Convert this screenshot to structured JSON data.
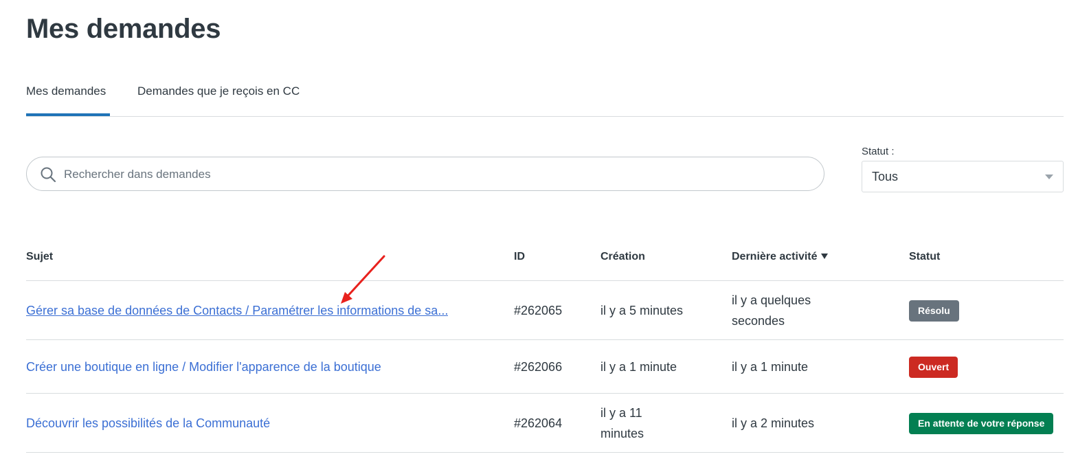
{
  "page": {
    "title": "Mes demandes"
  },
  "tabs": [
    {
      "label": "Mes demandes",
      "active": true
    },
    {
      "label": "Demandes que je reçois en CC",
      "active": false
    }
  ],
  "search": {
    "placeholder": "Rechercher dans demandes",
    "icon": "search-icon"
  },
  "status_filter": {
    "label": "Statut :",
    "selected": "Tous"
  },
  "table": {
    "headers": {
      "subject": "Sujet",
      "id": "ID",
      "created": "Création",
      "last_activity": "Dernière activité",
      "status": "Statut"
    },
    "rows": [
      {
        "subject": "Gérer sa base de données de Contacts / Paramétrer les informations de sa...",
        "id": "#262065",
        "created": "il y a 5 minutes",
        "last_activity": "il y a quelques secondes",
        "status": "Résolu",
        "status_color": "#68737d"
      },
      {
        "subject": "Créer une boutique en ligne / Modifier l'apparence de la boutique",
        "id": "#262066",
        "created": "il y a 1 minute",
        "last_activity": "il y a 1 minute",
        "status": "Ouvert",
        "status_color": "#cc3340"
      },
      {
        "subject": "Découvrir les possibilités de la Communauté",
        "id": "#262064",
        "created": "il y a 11 minutes",
        "last_activity": "il y a 2 minutes",
        "status": "En attente de votre réponse",
        "status_color": "#038153"
      }
    ]
  },
  "colors": {
    "link": "#3b6fd4",
    "tab_active_underline": "#1f73b7",
    "annotation_arrow": "#e01f1f"
  }
}
